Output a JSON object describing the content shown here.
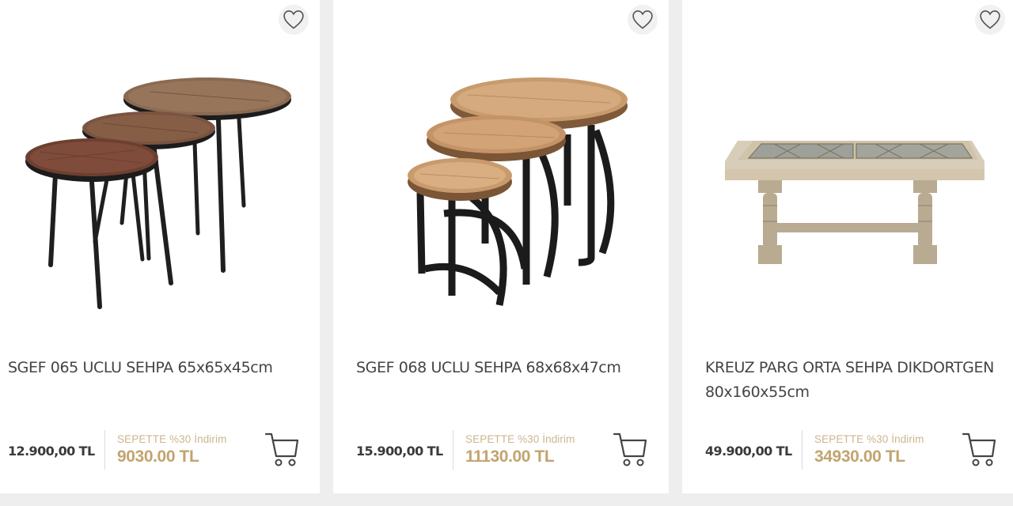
{
  "products": [
    {
      "title": "SGEF 065 UCLU SEHPA 65x65x45cm",
      "old_price": "12.900,00 TL",
      "promo": "SEPETTE %30 İndirim",
      "new_price": "9030.00 TL",
      "image": "nesting-tables-oval-dark-wood",
      "fav_icon": "heart-icon",
      "cart_icon": "cart-icon"
    },
    {
      "title": "SGEF 068 UCLU SEHPA 68x68x47cm",
      "old_price": "15.900,00 TL",
      "promo": "SEPETTE %30 İndirim",
      "new_price": "11130.00 TL",
      "image": "nesting-tables-round-natural-wood",
      "fav_icon": "heart-icon",
      "cart_icon": "cart-icon"
    },
    {
      "title": "KREUZ PARG ORTA SEHPA DIKDORTGEN 80x160x55cm",
      "old_price": "49.900,00 TL",
      "promo": "SEPETTE %30 İndirim",
      "new_price": "34930.00 TL",
      "image": "rectangular-coffee-table-parquet",
      "fav_icon": "heart-icon",
      "cart_icon": "cart-icon"
    }
  ],
  "colors": {
    "promo_accent": "#cdb58e",
    "new_price": "#c2a46f",
    "background": "#eeeeee"
  }
}
